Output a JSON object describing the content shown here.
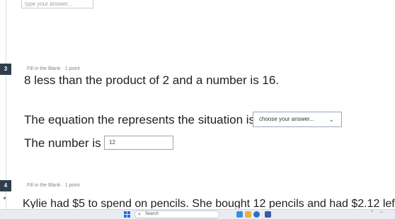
{
  "prev_question": {
    "answer_placeholder": "type your answer..."
  },
  "question3": {
    "number": "3",
    "type": "Fill in the Blank",
    "points": "1 point",
    "prompt": "8 less than the product of 2 and a number is 16.",
    "equation_label": "The equation the represents the situation is:",
    "equation_select": "choose your answer...",
    "number_label": "The number is",
    "number_value": "12"
  },
  "question4": {
    "number": "4",
    "type": "Fill in the Blank",
    "points": "1 point",
    "prompt_partial": "Kylie had $5 to spend on pencils. She bought 12 pencils and had $2.12 lef"
  },
  "taskbar": {
    "search_placeholder": "Search"
  },
  "colors": {
    "accent": "#1a73d9",
    "badge": "#2f3d4c",
    "border": "#9aa7b5"
  }
}
